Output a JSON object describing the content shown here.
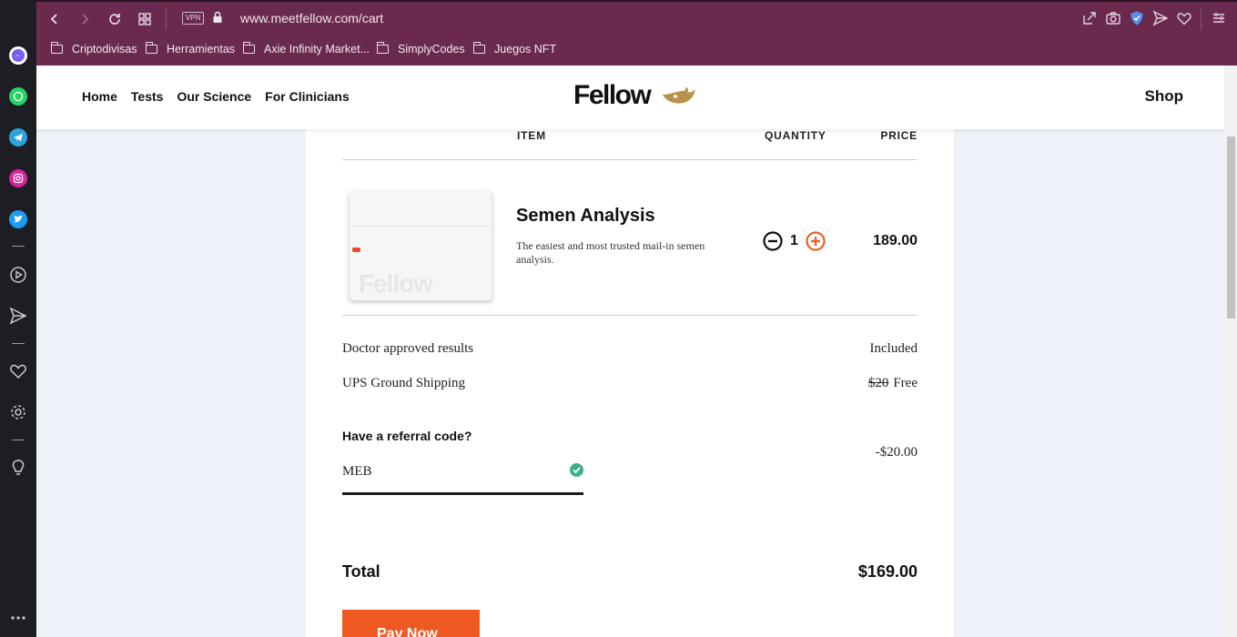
{
  "browser": {
    "url": "www.meetfellow.com/cart",
    "vpn_label": "VPN",
    "bookmarks": [
      "Criptodivisas",
      "Herramientas",
      "Axie Infinity Market...",
      "SimplyCodes",
      "Juegos NFT"
    ]
  },
  "site": {
    "nav": [
      "Home",
      "Tests",
      "Our Science",
      "For Clinicians"
    ],
    "logo_text": "Fellow",
    "shop_label": "Shop"
  },
  "cart": {
    "columns": {
      "item": "ITEM",
      "quantity": "QUANTITY",
      "price": "PRICE"
    },
    "product": {
      "name": "Semen Analysis",
      "description": "The easiest and most trusted mail-in semen analysis.",
      "image_watermark": "Fellow",
      "quantity": "1",
      "price": "189.00"
    },
    "lines": [
      {
        "label": "Doctor approved results",
        "value": "Included"
      },
      {
        "label": "UPS Ground Shipping",
        "old": "$20",
        "value": "Free"
      }
    ],
    "referral": {
      "question": "Have a referral code?",
      "code": "MEB",
      "discount": "-$20.00"
    },
    "total_label": "Total",
    "total_value": "$169.00",
    "pay_label": "Pay Now"
  }
}
